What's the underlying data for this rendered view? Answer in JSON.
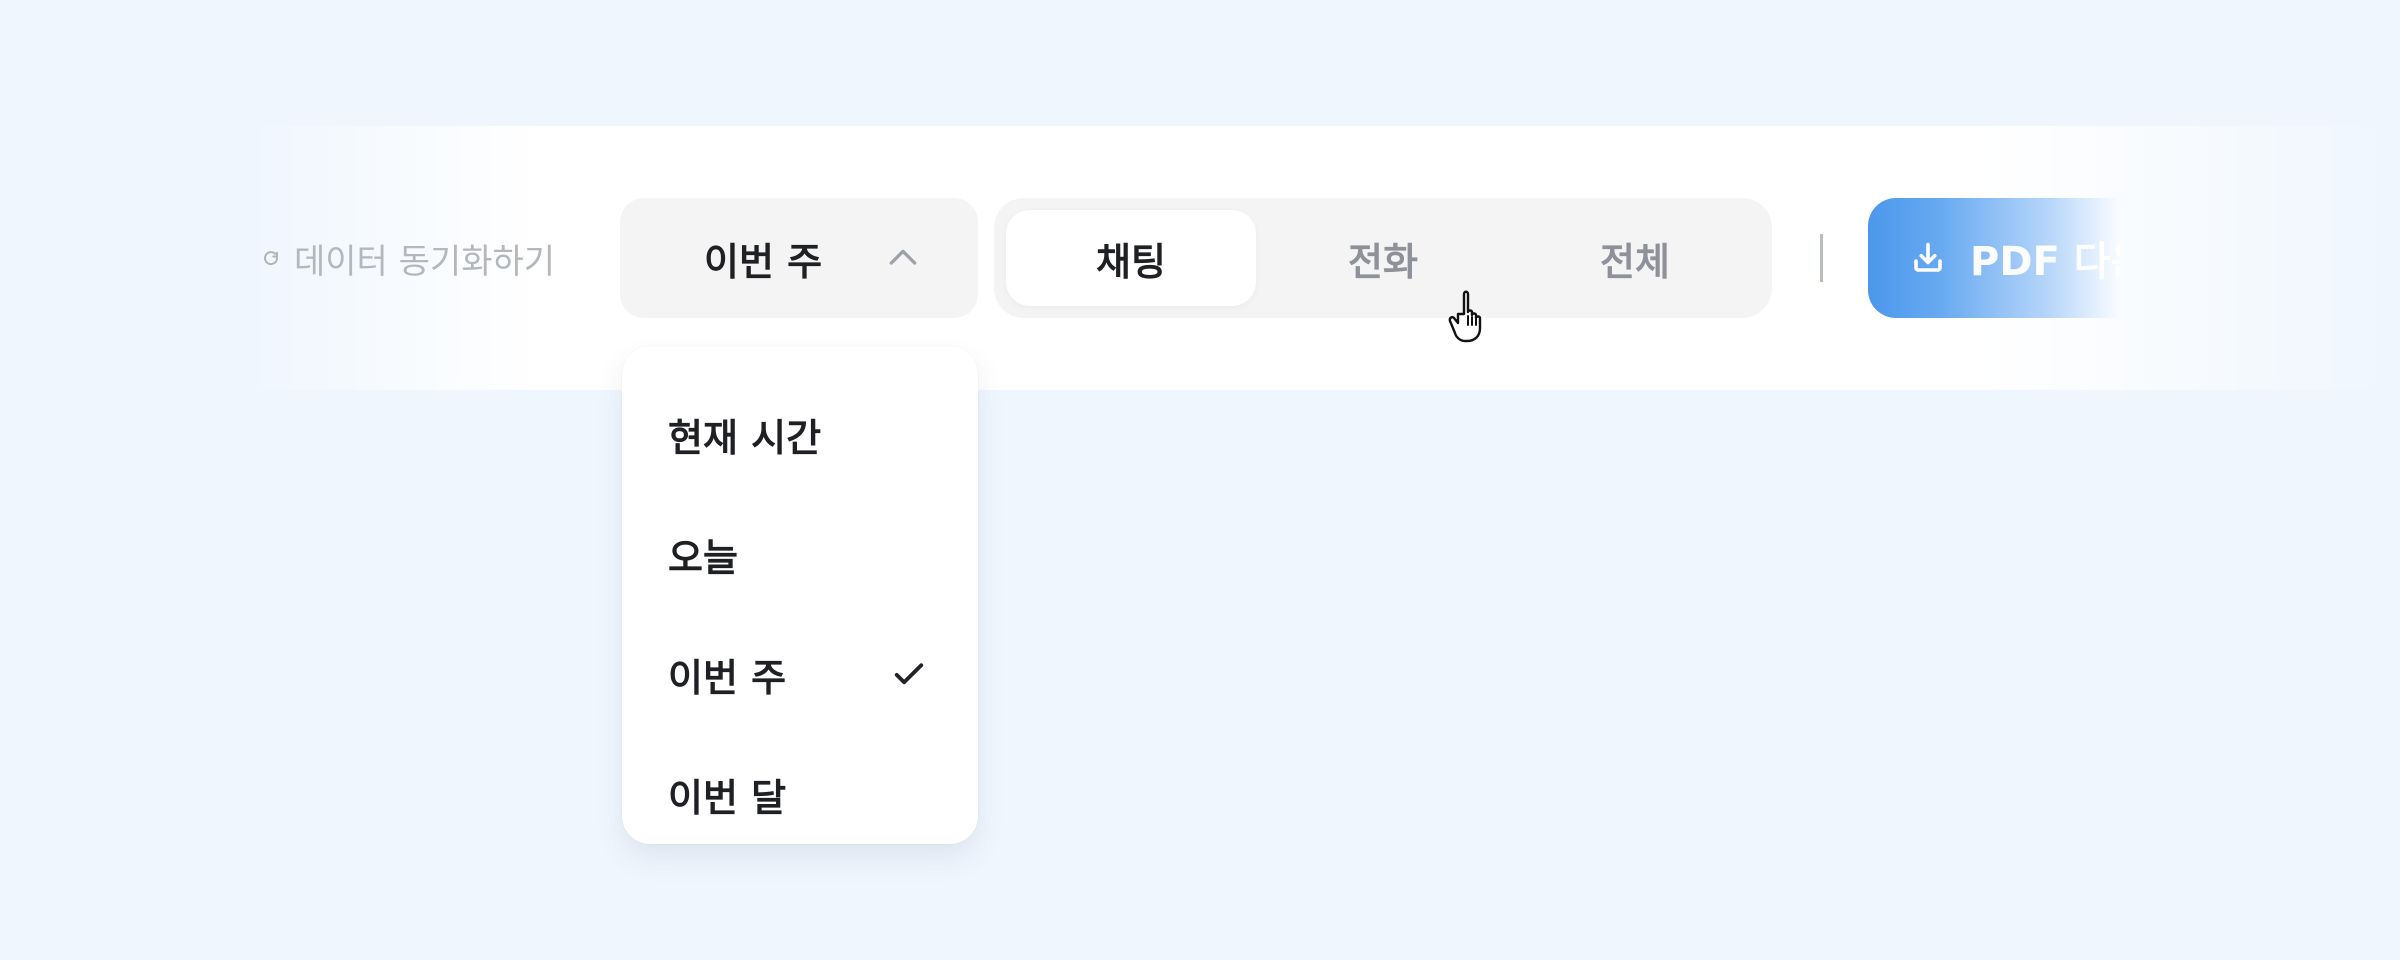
{
  "toolbar": {
    "sync_label": "데이터 동기화하기",
    "sync_icon": "refresh-icon",
    "period_selected": "이번 주",
    "period_icon": "chevron-up-icon",
    "segments": [
      {
        "label": "채팅",
        "active": true
      },
      {
        "label": "전화",
        "active": false
      },
      {
        "label": "전체",
        "active": false
      }
    ],
    "pdf_button": {
      "label": "PDF 다운",
      "icon": "download-icon",
      "color": "#4c97ec"
    }
  },
  "dropdown": {
    "items": [
      {
        "label": "현재 시간",
        "selected": false
      },
      {
        "label": "오늘",
        "selected": false
      },
      {
        "label": "이번 주",
        "selected": true
      },
      {
        "label": "이번 달",
        "selected": false
      }
    ],
    "selected_icon": "check-icon"
  },
  "cursor": {
    "type": "hand-pointer-cursor"
  }
}
